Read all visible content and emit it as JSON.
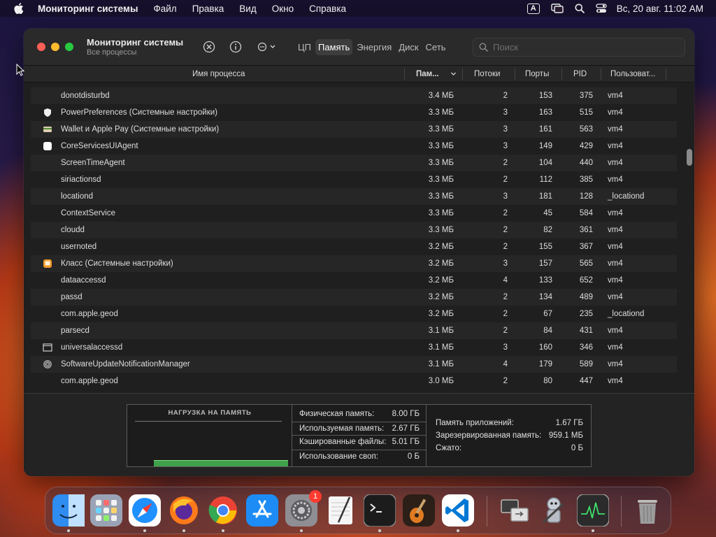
{
  "menubar": {
    "app_name": "Мониторинг системы",
    "items": [
      "Файл",
      "Правка",
      "Вид",
      "Окно",
      "Справка"
    ],
    "input_badge": "A",
    "clock": "Вс, 20 авг.  11:02 AM"
  },
  "window": {
    "title": "Мониторинг системы",
    "subtitle": "Все процессы",
    "tabs": [
      {
        "label": "ЦП",
        "active": false
      },
      {
        "label": "Память",
        "active": true
      },
      {
        "label": "Энергия",
        "active": false
      },
      {
        "label": "Диск",
        "active": false
      },
      {
        "label": "Сеть",
        "active": false
      }
    ],
    "search_placeholder": "Поиск"
  },
  "table": {
    "columns": {
      "name": "Имя процесса",
      "memory": "Пам...",
      "threads": "Потоки",
      "ports": "Порты",
      "pid": "PID",
      "user": "Пользоват..."
    },
    "rows": [
      {
        "name": "donotdisturbd",
        "icon": "",
        "memory": "3.4 МБ",
        "threads": "2",
        "ports": "153",
        "pid": "375",
        "user": "vm4"
      },
      {
        "name": "PowerPreferences (Системные настройки)",
        "icon": "shield-icon",
        "memory": "3.3 МБ",
        "threads": "3",
        "ports": "163",
        "pid": "515",
        "user": "vm4"
      },
      {
        "name": "Wallet и Apple Pay (Системные настройки)",
        "icon": "wallet-icon",
        "memory": "3.3 МБ",
        "threads": "3",
        "ports": "161",
        "pid": "563",
        "user": "vm4"
      },
      {
        "name": "CoreServicesUIAgent",
        "icon": "blank-app-icon",
        "memory": "3.3 МБ",
        "threads": "3",
        "ports": "149",
        "pid": "429",
        "user": "vm4"
      },
      {
        "name": "ScreenTimeAgent",
        "icon": "",
        "memory": "3.3 МБ",
        "threads": "2",
        "ports": "104",
        "pid": "440",
        "user": "vm4"
      },
      {
        "name": "siriactionsd",
        "icon": "",
        "memory": "3.3 МБ",
        "threads": "2",
        "ports": "112",
        "pid": "385",
        "user": "vm4"
      },
      {
        "name": "locationd",
        "icon": "",
        "memory": "3.3 МБ",
        "threads": "3",
        "ports": "181",
        "pid": "128",
        "user": "_locationd"
      },
      {
        "name": "ContextService",
        "icon": "",
        "memory": "3.3 МБ",
        "threads": "2",
        "ports": "45",
        "pid": "584",
        "user": "vm4"
      },
      {
        "name": "cloudd",
        "icon": "",
        "memory": "3.3 МБ",
        "threads": "2",
        "ports": "82",
        "pid": "361",
        "user": "vm4"
      },
      {
        "name": "usernoted",
        "icon": "",
        "memory": "3.2 МБ",
        "threads": "2",
        "ports": "155",
        "pid": "367",
        "user": "vm4"
      },
      {
        "name": "Класс (Системные настройки)",
        "icon": "classroom-icon",
        "memory": "3.2 МБ",
        "threads": "3",
        "ports": "157",
        "pid": "565",
        "user": "vm4"
      },
      {
        "name": "dataaccessd",
        "icon": "",
        "memory": "3.2 МБ",
        "threads": "4",
        "ports": "133",
        "pid": "652",
        "user": "vm4"
      },
      {
        "name": "passd",
        "icon": "",
        "memory": "3.2 МБ",
        "threads": "2",
        "ports": "134",
        "pid": "489",
        "user": "vm4"
      },
      {
        "name": "com.apple.geod",
        "icon": "",
        "memory": "3.2 МБ",
        "threads": "2",
        "ports": "67",
        "pid": "235",
        "user": "_locationd"
      },
      {
        "name": "parsecd",
        "icon": "",
        "memory": "3.1 МБ",
        "threads": "2",
        "ports": "84",
        "pid": "431",
        "user": "vm4"
      },
      {
        "name": "universalaccessd",
        "icon": "window-icon",
        "memory": "3.1 МБ",
        "threads": "3",
        "ports": "160",
        "pid": "346",
        "user": "vm4"
      },
      {
        "name": "SoftwareUpdateNotificationManager",
        "icon": "gear-icon",
        "memory": "3.1 МБ",
        "threads": "4",
        "ports": "179",
        "pid": "589",
        "user": "vm4"
      },
      {
        "name": "com.apple.geod",
        "icon": "",
        "memory": "3.0 МБ",
        "threads": "2",
        "ports": "80",
        "pid": "447",
        "user": "vm4"
      }
    ]
  },
  "memory_panel": {
    "pressure_title": "НАГРУЗКА НА ПАМЯТЬ",
    "pressure_level": 0.07,
    "stats_a": [
      {
        "label": "Физическая память:",
        "value": "8.00 ГБ"
      },
      {
        "label": "Используемая память:",
        "value": "2.67 ГБ"
      },
      {
        "label": "Кэшированные файлы:",
        "value": "5.01 ГБ"
      },
      {
        "label": "Использование своп:",
        "value": "0 Б"
      }
    ],
    "stats_b": [
      {
        "label": "Память приложений:",
        "value": "1.67 ГБ"
      },
      {
        "label": "Зарезервированная память:",
        "value": "959.1 МБ"
      },
      {
        "label": "Сжато:",
        "value": "0 Б"
      }
    ]
  },
  "dock": {
    "items": [
      {
        "name": "finder-icon",
        "color": "#2f8cf0",
        "running": true
      },
      {
        "name": "launchpad-icon",
        "color": "#9aa3b5",
        "running": false
      },
      {
        "name": "safari-icon",
        "color": "#1e90ff",
        "running": true
      },
      {
        "name": "firefox-icon",
        "color": "#ff7a1a",
        "running": true
      },
      {
        "name": "chrome-icon",
        "color": "#e8e8e8",
        "running": true
      },
      {
        "name": "app-store-icon",
        "color": "#1e8cf5",
        "running": false
      },
      {
        "name": "system-settings-icon",
        "color": "#8e8e93",
        "running": true,
        "badge": "1"
      },
      {
        "name": "textedit-icon",
        "color": "#f5f5f5",
        "running": false
      },
      {
        "name": "terminal-icon",
        "color": "#1c1c1c",
        "running": true
      },
      {
        "name": "garageband-icon",
        "color": "#3a2a1a",
        "running": false
      },
      {
        "name": "vscode-icon",
        "color": "#ffffff",
        "running": true
      },
      {
        "name": "migration-assistant-icon",
        "color": "#d8d8d8",
        "running": false
      },
      {
        "name": "automator-icon",
        "color": "#c9ced6",
        "running": false
      },
      {
        "name": "activity-monitor-icon",
        "color": "#2b2b2b",
        "running": true
      },
      {
        "name": "trash-icon",
        "color": "#9c9c9c",
        "running": false
      }
    ]
  },
  "colors": {
    "accent_green": "#3fa24a",
    "close": "#fe5f57",
    "minimize": "#febc2e",
    "zoom": "#28c840"
  }
}
